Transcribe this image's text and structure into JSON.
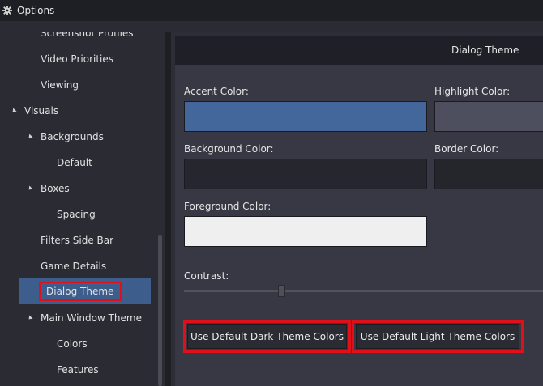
{
  "window": {
    "title": "Options",
    "icon": "gear-icon"
  },
  "sidebar": {
    "items": [
      {
        "label": "Screenshot Profiles",
        "level": 1,
        "arrow": false
      },
      {
        "label": "Video Priorities",
        "level": 1,
        "arrow": false
      },
      {
        "label": "Viewing",
        "level": 1,
        "arrow": false
      },
      {
        "label": "Visuals",
        "level": 0,
        "arrow": true
      },
      {
        "label": "Backgrounds",
        "level": 1,
        "arrow": true
      },
      {
        "label": "Default",
        "level": 2,
        "arrow": false
      },
      {
        "label": "Boxes",
        "level": 1,
        "arrow": true
      },
      {
        "label": "Spacing",
        "level": 2,
        "arrow": false
      },
      {
        "label": "Filters Side Bar",
        "level": 1,
        "arrow": false
      },
      {
        "label": "Game Details",
        "level": 1,
        "arrow": false
      },
      {
        "label": "Dialog Theme",
        "level": 1,
        "arrow": false,
        "selected": true
      },
      {
        "label": "Main Window Theme",
        "level": 1,
        "arrow": true
      },
      {
        "label": "Colors",
        "level": 2,
        "arrow": false
      },
      {
        "label": "Features",
        "level": 2,
        "arrow": false
      }
    ]
  },
  "main": {
    "header_title": "Dialog Theme",
    "fields": {
      "accent": {
        "label": "Accent Color:",
        "color": "#43679a"
      },
      "highlight": {
        "label": "Highlight Color:",
        "color": "#4e4f5e"
      },
      "background": {
        "label": "Background Color:",
        "color": "#26272e"
      },
      "border": {
        "label": "Border Color:",
        "color": "#25262c"
      },
      "foreground": {
        "label": "Foreground Color:",
        "color": "#efefef"
      }
    },
    "contrast_label": "Contrast:",
    "buttons": {
      "dark": "Use Default Dark Theme Colors",
      "light": "Use Default Light Theme Colors"
    }
  },
  "colors": {
    "selection": "#3d5e8c",
    "highlight_outline": "#e0101a"
  }
}
